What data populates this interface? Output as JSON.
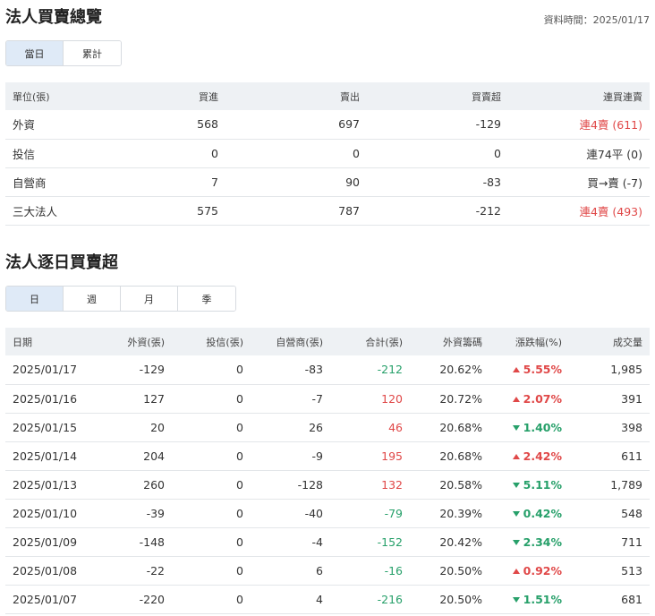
{
  "summary": {
    "title": "法人買賣總覽",
    "data_time": "資料時間：2025/01/17",
    "tabs": [
      {
        "label": "當日",
        "active": true
      },
      {
        "label": "累計",
        "active": false
      }
    ],
    "headers": [
      "單位(張)",
      "買進",
      "賣出",
      "買賣超",
      "連買連賣"
    ],
    "rows": [
      {
        "name": "外資",
        "buy": "568",
        "sell": "697",
        "net": "-129",
        "streak": "連4賣 (611)",
        "streak_color": "red"
      },
      {
        "name": "投信",
        "buy": "0",
        "sell": "0",
        "net": "0",
        "streak": "連74平 (0)",
        "streak_color": "normal"
      },
      {
        "name": "自營商",
        "buy": "7",
        "sell": "90",
        "net": "-83",
        "streak": "買→賣 (-7)",
        "streak_color": "normal"
      },
      {
        "name": "三大法人",
        "buy": "575",
        "sell": "787",
        "net": "-212",
        "streak": "連4賣 (493)",
        "streak_color": "red"
      }
    ]
  },
  "daily": {
    "title": "法人逐日買賣超",
    "tabs": [
      {
        "label": "日",
        "active": true
      },
      {
        "label": "週",
        "active": false
      },
      {
        "label": "月",
        "active": false
      },
      {
        "label": "季",
        "active": false
      }
    ],
    "headers": [
      "日期",
      "外資(張)",
      "投信(張)",
      "自營商(張)",
      "合計(張)",
      "外資籌碼",
      "漲跌幅(%)",
      "成交量"
    ],
    "rows": [
      {
        "date": "2025/01/17",
        "foreign": "-129",
        "trust": "0",
        "dealer": "-83",
        "total": "-212",
        "total_dir": "down",
        "holding": "20.62%",
        "change": "5.55%",
        "change_dir": "up",
        "volume": "1,985"
      },
      {
        "date": "2025/01/16",
        "foreign": "127",
        "trust": "0",
        "dealer": "-7",
        "total": "120",
        "total_dir": "up",
        "holding": "20.72%",
        "change": "2.07%",
        "change_dir": "up",
        "volume": "391"
      },
      {
        "date": "2025/01/15",
        "foreign": "20",
        "trust": "0",
        "dealer": "26",
        "total": "46",
        "total_dir": "up",
        "holding": "20.68%",
        "change": "1.40%",
        "change_dir": "down",
        "volume": "398"
      },
      {
        "date": "2025/01/14",
        "foreign": "204",
        "trust": "0",
        "dealer": "-9",
        "total": "195",
        "total_dir": "up",
        "holding": "20.68%",
        "change": "2.42%",
        "change_dir": "up",
        "volume": "611"
      },
      {
        "date": "2025/01/13",
        "foreign": "260",
        "trust": "0",
        "dealer": "-128",
        "total": "132",
        "total_dir": "up",
        "holding": "20.58%",
        "change": "5.11%",
        "change_dir": "down",
        "volume": "1,789"
      },
      {
        "date": "2025/01/10",
        "foreign": "-39",
        "trust": "0",
        "dealer": "-40",
        "total": "-79",
        "total_dir": "down",
        "holding": "20.39%",
        "change": "0.42%",
        "change_dir": "down",
        "volume": "548"
      },
      {
        "date": "2025/01/09",
        "foreign": "-148",
        "trust": "0",
        "dealer": "-4",
        "total": "-152",
        "total_dir": "down",
        "holding": "20.42%",
        "change": "2.34%",
        "change_dir": "down",
        "volume": "711"
      },
      {
        "date": "2025/01/08",
        "foreign": "-22",
        "trust": "0",
        "dealer": "6",
        "total": "-16",
        "total_dir": "down",
        "holding": "20.50%",
        "change": "0.92%",
        "change_dir": "up",
        "volume": "513"
      },
      {
        "date": "2025/01/07",
        "foreign": "-220",
        "trust": "0",
        "dealer": "4",
        "total": "-216",
        "total_dir": "down",
        "holding": "20.50%",
        "change": "1.51%",
        "change_dir": "down",
        "volume": "681"
      }
    ]
  },
  "colors": {
    "up": "#e04848",
    "down": "#27a06a",
    "header_bg": "#eef1f4",
    "tab_active_bg": "#dfeaf7"
  },
  "icons": {
    "up": "triangle-up-icon",
    "down": "triangle-down-icon"
  }
}
